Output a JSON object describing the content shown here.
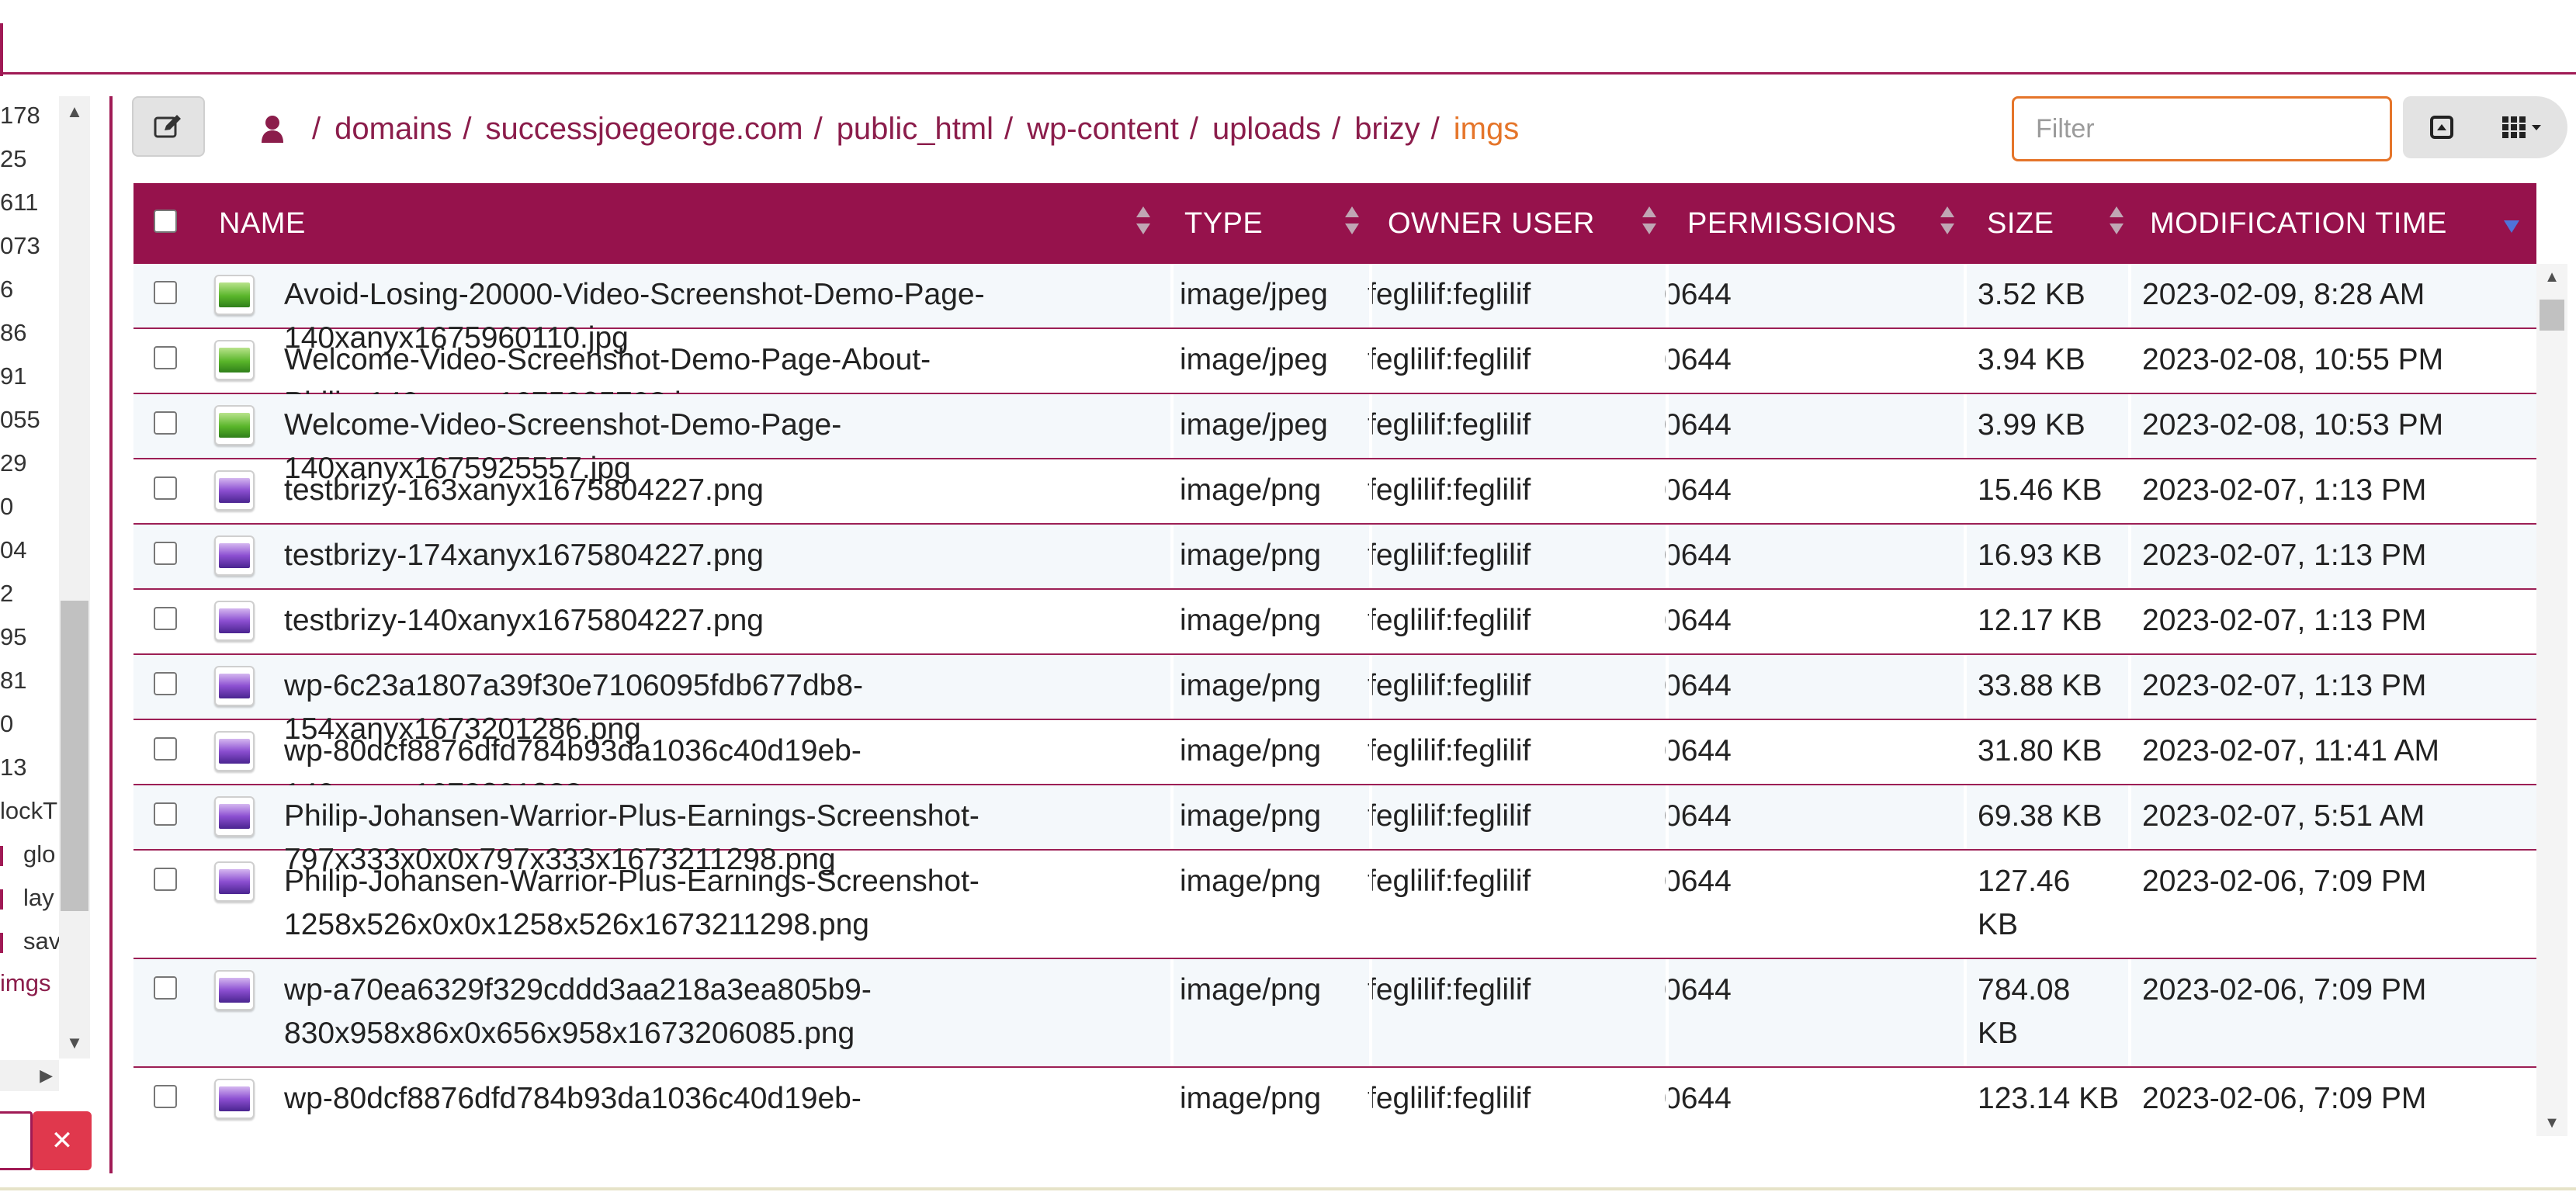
{
  "tree": {
    "numbers": [
      "178",
      "25",
      "611",
      "073",
      "6",
      "86",
      "91",
      "055",
      "29",
      "0",
      "04",
      "2",
      "95",
      "81",
      "0",
      "13"
    ],
    "partial_label": "lockT",
    "sub_items": [
      "glo",
      "lay",
      "sav"
    ],
    "link_item": "imgs",
    "clear_icon": "times-icon",
    "clear_color": "#e0384d"
  },
  "toolbar": {
    "edit_icon": "edit-icon",
    "user_icon": "user-icon",
    "breadcrumb": [
      "domains",
      "successjoegeorge.com",
      "public_html",
      "wp-content",
      "uploads",
      "brizy"
    ],
    "current": "imgs",
    "separator": "/",
    "filter_placeholder": "Filter",
    "view_icons": [
      "fit-icon",
      "grid-icon"
    ]
  },
  "colors": {
    "accent": "#96124c",
    "link": "#8b1d4b",
    "current": "#e5752a",
    "filter_border": "#e5752a"
  },
  "table": {
    "columns": [
      "NAME",
      "TYPE",
      "OWNER USER",
      "PERMISSIONS",
      "SIZE",
      "MODIFICATION TIME"
    ],
    "sorted_by": "MODIFICATION TIME",
    "sort_direction": "descending",
    "rows": [
      {
        "name": "Avoid-Losing-20000-Video-Screenshot-Demo-Page-140xanyx1675960110.jpg",
        "name_lines": [
          "Avoid-Losing-20000-Video-Screenshot-Demo-Page-",
          "140xanyx1675960110.jpg"
        ],
        "type": "image/jpeg",
        "owner": "feglilif:feglilif",
        "perms": "0644",
        "size": "3.52 KB",
        "size_lines": [
          "3.52 KB"
        ],
        "mtime": "2023-02-09, 8:28 AM"
      },
      {
        "name": "Welcome-Video-Screenshot-Demo-Page-About-Philip-140xanyx1675925708.jpg",
        "name_lines": [
          "Welcome-Video-Screenshot-Demo-Page-About-",
          "Philip-140xanyx1675925708.jpg"
        ],
        "type": "image/jpeg",
        "owner": "feglilif:feglilif",
        "perms": "0644",
        "size": "3.94 KB",
        "size_lines": [
          "3.94 KB"
        ],
        "mtime": "2023-02-08, 10:55 PM"
      },
      {
        "name": "Welcome-Video-Screenshot-Demo-Page-140xanyx1675925557.jpg",
        "name_lines": [
          "Welcome-Video-Screenshot-Demo-Page-",
          "140xanyx1675925557.jpg"
        ],
        "type": "image/jpeg",
        "owner": "feglilif:feglilif",
        "perms": "0644",
        "size": "3.99 KB",
        "size_lines": [
          "3.99 KB"
        ],
        "mtime": "2023-02-08, 10:53 PM"
      },
      {
        "name": "testbrizy-163xanyx1675804227.png",
        "name_lines": [
          "testbrizy-163xanyx1675804227.png"
        ],
        "type": "image/png",
        "owner": "feglilif:feglilif",
        "perms": "0644",
        "size": "15.46 KB",
        "size_lines": [
          "15.46 KB"
        ],
        "mtime": "2023-02-07, 1:13 PM"
      },
      {
        "name": "testbrizy-174xanyx1675804227.png",
        "name_lines": [
          "testbrizy-174xanyx1675804227.png"
        ],
        "type": "image/png",
        "owner": "feglilif:feglilif",
        "perms": "0644",
        "size": "16.93 KB",
        "size_lines": [
          "16.93 KB"
        ],
        "mtime": "2023-02-07, 1:13 PM"
      },
      {
        "name": "testbrizy-140xanyx1675804227.png",
        "name_lines": [
          "testbrizy-140xanyx1675804227.png"
        ],
        "type": "image/png",
        "owner": "feglilif:feglilif",
        "perms": "0644",
        "size": "12.17 KB",
        "size_lines": [
          "12.17 KB"
        ],
        "mtime": "2023-02-07, 1:13 PM"
      },
      {
        "name": "wp-6c23a1807a39f30e7106095fdb677db8-154xanyx1673201286.png",
        "name_lines": [
          "wp-6c23a1807a39f30e7106095fdb677db8-",
          "154xanyx1673201286.png"
        ],
        "type": "image/png",
        "owner": "feglilif:feglilif",
        "perms": "0644",
        "size": "33.88 KB",
        "size_lines": [
          "33.88 KB"
        ],
        "mtime": "2023-02-07, 1:13 PM"
      },
      {
        "name": "wp-80dcf8876dfd784b93da1036c40d19eb-140xanyx1673201288.png",
        "name_lines": [
          "wp-80dcf8876dfd784b93da1036c40d19eb-",
          "140xanyx1673201288.png"
        ],
        "type": "image/png",
        "owner": "feglilif:feglilif",
        "perms": "0644",
        "size": "31.80 KB",
        "size_lines": [
          "31.80 KB"
        ],
        "mtime": "2023-02-07, 11:41 AM"
      },
      {
        "name": "Philip-Johansen-Warrior-Plus-Earnings-Screenshot-797x333x0x0x797x333x1673211298.png",
        "name_lines": [
          "Philip-Johansen-Warrior-Plus-Earnings-Screenshot-",
          "797x333x0x0x797x333x1673211298.png"
        ],
        "type": "image/png",
        "owner": "feglilif:feglilif",
        "perms": "0644",
        "size": "69.38 KB",
        "size_lines": [
          "69.38 KB"
        ],
        "mtime": "2023-02-07, 5:51 AM"
      },
      {
        "name": "Philip-Johansen-Warrior-Plus-Earnings-Screenshot-1258x526x0x0x1258x526x1673211298.png",
        "name_lines": [
          "Philip-Johansen-Warrior-Plus-Earnings-Screenshot-",
          "1258x526x0x0x1258x526x1673211298.png"
        ],
        "type": "image/png",
        "owner": "feglilif:feglilif",
        "perms": "0644",
        "size": "127.46 KB",
        "size_lines": [
          "127.46",
          "KB"
        ],
        "mtime": "2023-02-06, 7:09 PM"
      },
      {
        "name": "wp-a70ea6329f329cddd3aa218a3ea805b9-830x958x86x0x656x958x1673206085.png",
        "name_lines": [
          "wp-a70ea6329f329cddd3aa218a3ea805b9-",
          "830x958x86x0x656x958x1673206085.png"
        ],
        "type": "image/png",
        "owner": "feglilif:feglilif",
        "perms": "0644",
        "size": "784.08 KB",
        "size_lines": [
          "784.08",
          "KB"
        ],
        "mtime": "2023-02-06, 7:09 PM"
      },
      {
        "name": "wp-80dcf8876dfd784b93da1036c40d19eb-",
        "name_lines": [
          "wp-80dcf8876dfd784b93da1036c40d19eb-"
        ],
        "type": "image/png",
        "owner": "feglilif:feglilif",
        "perms": "0644",
        "size": "123.14 KB",
        "size_lines": [
          "123.14 KB"
        ],
        "mtime": "2023-02-06, 7:09 PM"
      }
    ]
  }
}
